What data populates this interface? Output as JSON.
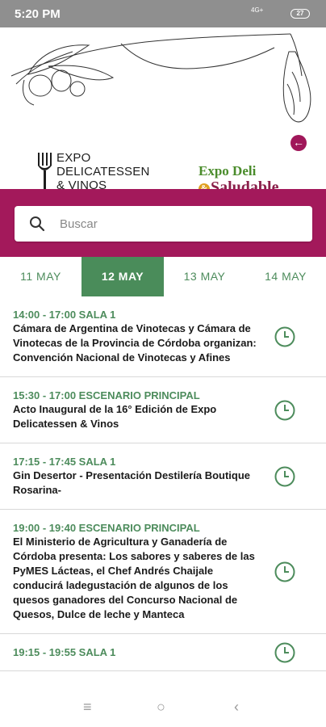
{
  "status": {
    "time": "5:20 PM",
    "network": "4G+",
    "battery": "27"
  },
  "header": {
    "logo_expo_lines": [
      "EXPO",
      "DELICATESSEN",
      "& VINOS"
    ],
    "logo_deli_line1": "Expo Deli",
    "logo_deli_amp": "&",
    "logo_deli_line2": "Saludable",
    "back_icon": "arrow-left-icon"
  },
  "search": {
    "placeholder": "Buscar",
    "icon": "search-icon"
  },
  "tabs": [
    {
      "label": "11 MAY",
      "active": false
    },
    {
      "label": "12 MAY",
      "active": true
    },
    {
      "label": "13 MAY",
      "active": false
    },
    {
      "label": "14 MAY",
      "active": false
    }
  ],
  "events": [
    {
      "when": "14:00 - 17:00 SALA 1",
      "title": "Cámara de Argentina de Vinotecas y Cámara de Vinotecas de la Provincia de Córdoba organizan: Convención Nacional de Vinotecas y Afines"
    },
    {
      "when": "15:30 - 17:00 ESCENARIO PRINCIPAL",
      "title": "Acto Inaugural de la 16° Edición de Expo Delicatessen & Vinos"
    },
    {
      "when": "17:15 - 17:45 SALA 1",
      "title": "Gin Desertor - Presentación Destilería Boutique Rosarina-"
    },
    {
      "when": "19:00 - 19:40 ESCENARIO PRINCIPAL",
      "title": "El Ministerio de Agricultura y Ganadería de Córdoba presenta: Los sabores y saberes de las PyMES Lácteas, el Chef Andrés Chaijale conducirá ladegustación de algunos de los quesos ganadores del Concurso Nacional de Quesos, Dulce de leche y Manteca"
    },
    {
      "when": "19:15 - 19:55 SALA 1",
      "title": ""
    }
  ],
  "colors": {
    "brand": "#a3195b",
    "green": "#4a8c5a"
  },
  "navbar": {
    "menu": "≡",
    "home": "○",
    "back": "‹"
  }
}
